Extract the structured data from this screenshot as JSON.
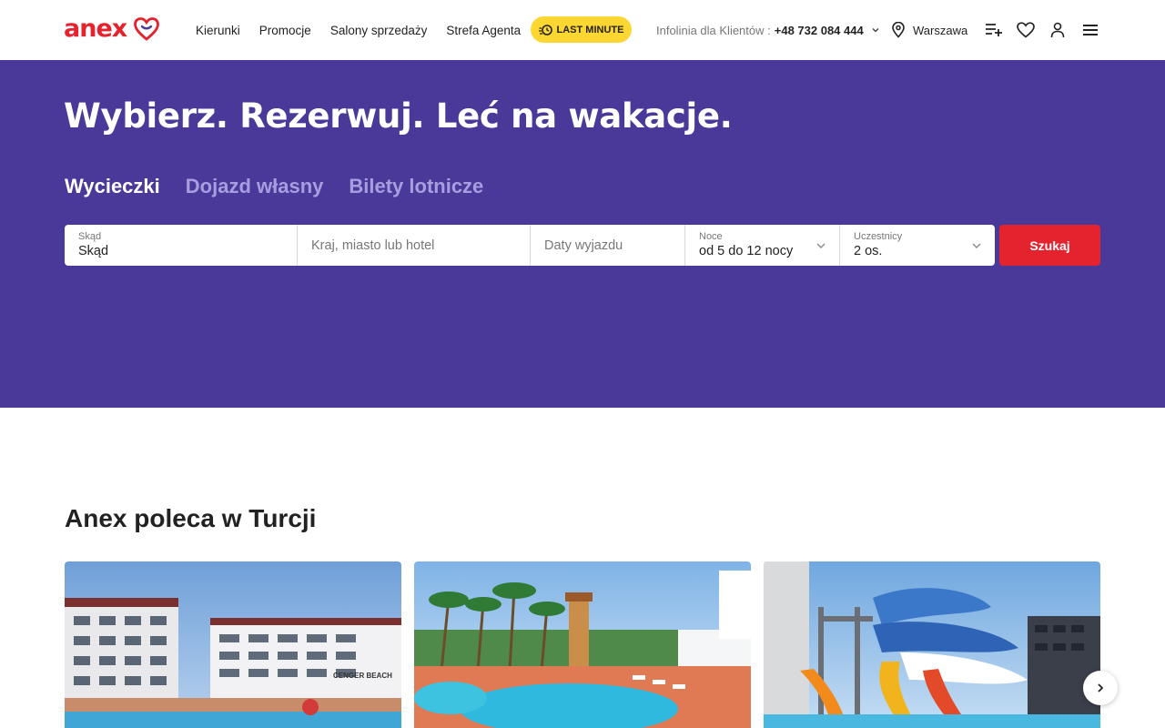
{
  "brand": {
    "logo_text": "anex",
    "accent": "#e5232f",
    "hero_bg": "#4b399a",
    "lastminute_bg": "#fcd631"
  },
  "header": {
    "nav": [
      "Kierunki",
      "Promocje",
      "Salony sprzedaży",
      "Strefa Agenta"
    ],
    "lastminute_label": "LAST MINUTE",
    "hotline_label": "Infolinia dla Klientów :",
    "hotline_phone": "+48 732 084 444",
    "city": "Warszawa",
    "icons": [
      "add-to-list-icon",
      "heart-icon",
      "user-icon",
      "menu-icon"
    ]
  },
  "hero": {
    "title": "Wybierz. Rezerwuj. Leć na wakacje.",
    "tabs": [
      "Wycieczki",
      "Dojazd własny",
      "Bilety lotnicze"
    ],
    "active_tab": 0
  },
  "search": {
    "from": {
      "label": "Skąd",
      "value": "Skąd"
    },
    "destination": {
      "placeholder": "Kraj, miasto lub hotel"
    },
    "dates": {
      "placeholder": "Daty wyjazdu"
    },
    "nights": {
      "label": "Noce",
      "value": "od 5 do 12 nocy"
    },
    "participants": {
      "label": "Uczestnicy",
      "value": "2 os."
    },
    "button": "Szukaj"
  },
  "recommend": {
    "title": "Anex poleca w Turcji",
    "cards": [
      {
        "hotel_sign": "CENGER BEACH"
      },
      {
        "hotel_sign": ""
      },
      {
        "hotel_sign": ""
      }
    ]
  }
}
